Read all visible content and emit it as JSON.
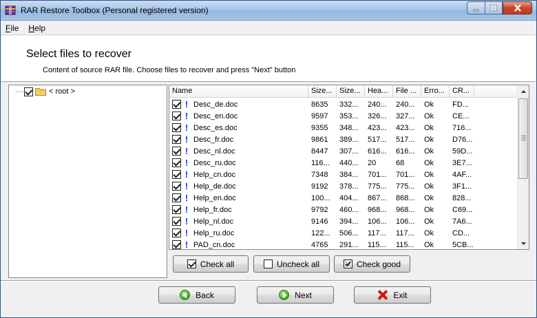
{
  "window": {
    "title": "RAR Restore Toolbox (Personal registered version)",
    "minimize_label": "–",
    "maximize_label": "▫",
    "close_label": "✕"
  },
  "menu": {
    "file": {
      "accel": "F",
      "rest": "ile"
    },
    "help": {
      "accel": "H",
      "rest": "elp"
    }
  },
  "header": {
    "title": "Select files to recover",
    "subtitle": "Content of source RAR file. Choose files to recover and press \"Next\" button"
  },
  "tree": {
    "root_label": "< root >",
    "root_checked": true
  },
  "list": {
    "columns": [
      "Name",
      "Size...",
      "Size...",
      "Hea...",
      "File ...",
      "Erro...",
      "CR..."
    ],
    "rows": [
      {
        "checked": true,
        "name": "Desc_de.doc",
        "size": "8635",
        "packed": "332...",
        "header": "240...",
        "file": "240...",
        "error": "Ok",
        "crc": "FD..."
      },
      {
        "checked": true,
        "name": "Desc_en.doc",
        "size": "9597",
        "packed": "353...",
        "header": "326...",
        "file": "327...",
        "error": "Ok",
        "crc": "CE..."
      },
      {
        "checked": true,
        "name": "Desc_es.doc",
        "size": "9355",
        "packed": "348...",
        "header": "423...",
        "file": "423...",
        "error": "Ok",
        "crc": "716..."
      },
      {
        "checked": true,
        "name": "Desc_fr.doc",
        "size": "9861",
        "packed": "389...",
        "header": "517...",
        "file": "517...",
        "error": "Ok",
        "crc": "D76..."
      },
      {
        "checked": true,
        "name": "Desc_nl.doc",
        "size": "8447",
        "packed": "307...",
        "header": "616...",
        "file": "616...",
        "error": "Ok",
        "crc": "59D..."
      },
      {
        "checked": true,
        "name": "Desc_ru.doc",
        "size": "116...",
        "packed": "440...",
        "header": "20",
        "file": "68",
        "error": "Ok",
        "crc": "3E7..."
      },
      {
        "checked": true,
        "name": "Help_cn.doc",
        "size": "7348",
        "packed": "384...",
        "header": "701...",
        "file": "701...",
        "error": "Ok",
        "crc": "4AF..."
      },
      {
        "checked": true,
        "name": "Help_de.doc",
        "size": "9192",
        "packed": "378...",
        "header": "775...",
        "file": "775...",
        "error": "Ok",
        "crc": "3F1..."
      },
      {
        "checked": true,
        "name": "Help_en.doc",
        "size": "100...",
        "packed": "404...",
        "header": "867...",
        "file": "868...",
        "error": "Ok",
        "crc": "828..."
      },
      {
        "checked": true,
        "name": "Help_fr.doc",
        "size": "9792",
        "packed": "460...",
        "header": "968...",
        "file": "968...",
        "error": "Ok",
        "crc": "C69..."
      },
      {
        "checked": true,
        "name": "Help_nl.doc",
        "size": "9146",
        "packed": "394...",
        "header": "106...",
        "file": "106...",
        "error": "Ok",
        "crc": "7A6..."
      },
      {
        "checked": true,
        "name": "Help_ru.doc",
        "size": "122...",
        "packed": "506...",
        "header": "117...",
        "file": "117...",
        "error": "Ok",
        "crc": "CD..."
      },
      {
        "checked": true,
        "name": "PAD_cn.doc",
        "size": "4765",
        "packed": "291...",
        "header": "115...",
        "file": "115...",
        "error": "Ok",
        "crc": "5CB..."
      }
    ],
    "status_marker": "!"
  },
  "actions": {
    "check_all": "Check all",
    "uncheck_all": "Uncheck all",
    "check_good": "Check good"
  },
  "nav": {
    "back": "Back",
    "next": "Next",
    "exit": "Exit"
  },
  "colors": {
    "titlebar": "#a9c6e8",
    "close_button": "#c8452c",
    "status_marker": "#1a3ccf"
  }
}
